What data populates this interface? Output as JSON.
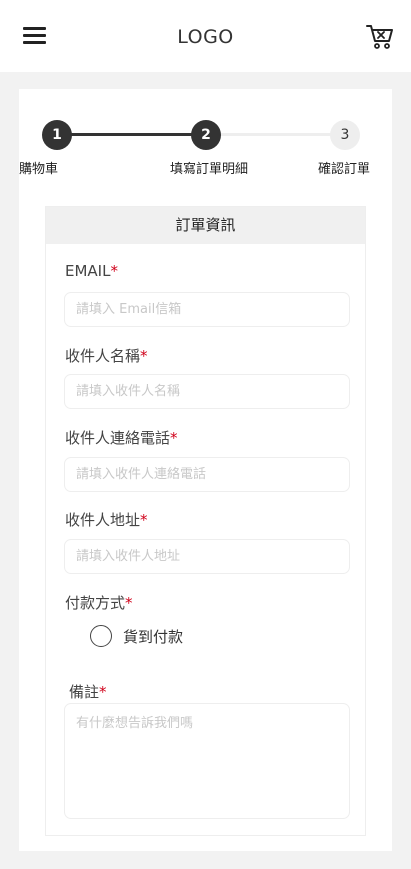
{
  "navbar": {
    "logo": "LOGO",
    "menu_icon": "hamburger-menu-icon",
    "cart_icon": "cart-icon"
  },
  "stepper": {
    "steps": [
      {
        "number": "1",
        "label": "購物車",
        "state": "done"
      },
      {
        "number": "2",
        "label": "填寫訂單明細",
        "state": "current"
      },
      {
        "number": "3",
        "label": "確認訂單",
        "state": "todo"
      }
    ]
  },
  "form": {
    "header": "訂單資訊",
    "required_mark": "*",
    "email": {
      "label": "EMAIL",
      "placeholder": "請填入 Email信箱",
      "value": ""
    },
    "name": {
      "label": "收件人名稱",
      "placeholder": "請填入收件人名稱",
      "value": ""
    },
    "phone": {
      "label": "收件人連絡電話",
      "placeholder": "請填入收件人連絡電話",
      "value": ""
    },
    "address": {
      "label": "收件人地址",
      "placeholder": "請填入收件人地址",
      "value": ""
    },
    "payment": {
      "label": "付款方式",
      "option": "貨到付款",
      "selected": false
    },
    "note": {
      "label": "備註",
      "placeholder": "有什麼想告訴我們嗎",
      "value": ""
    }
  },
  "colors": {
    "accent": "#333333",
    "required": "#d0021b",
    "step_inactive": "#eeeeee",
    "page_background": "#f2f2f2"
  }
}
